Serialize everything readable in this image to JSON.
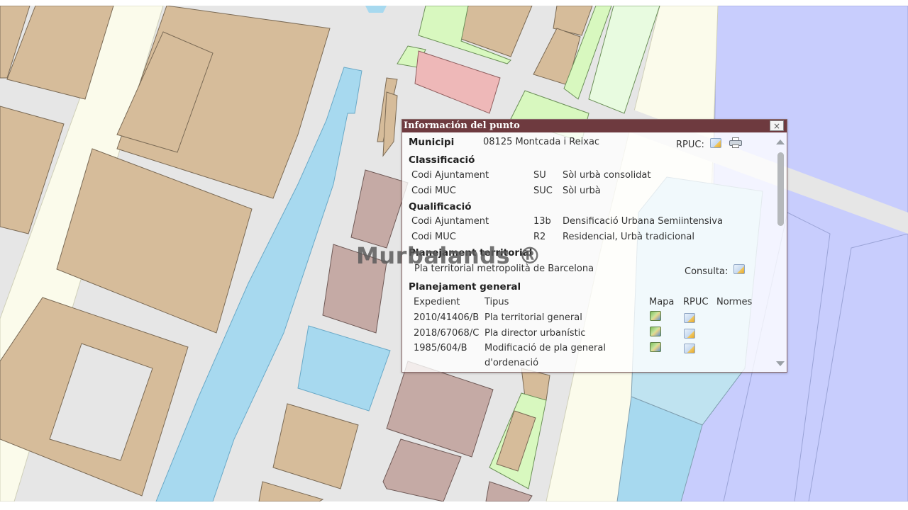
{
  "popup": {
    "title": "Información del punto",
    "close_label": "×",
    "municipi_label": "Municipi",
    "municipi_value": "08125 Montcada i Reixac",
    "rpuc_label": "RPUC:",
    "classificacio": {
      "heading": "Classificació",
      "rows": [
        {
          "label": "Codi Ajuntament",
          "code": "SU",
          "desc": "Sòl urbà consolidat"
        },
        {
          "label": "Codi MUC",
          "code": "SUC",
          "desc": "Sòl urbà"
        }
      ]
    },
    "qualificacio": {
      "heading": "Qualificació",
      "rows": [
        {
          "label": "Codi Ajuntament",
          "code": "13b",
          "desc": "Densificació Urbana Semiintensiva"
        },
        {
          "label": "Codi MUC",
          "code": "R2",
          "desc": "Residencial, Urbà tradicional"
        }
      ]
    },
    "territorial": {
      "heading": "Planejament territorial",
      "value": "Pla territorial metropolità de Barcelona",
      "consulta_label": "Consulta:"
    },
    "general": {
      "heading": "Planejament general",
      "columns": {
        "expedient": "Expedient",
        "tipus": "Tipus",
        "mapa": "Mapa",
        "rpuc": "RPUC",
        "normes": "Normes"
      },
      "rows": [
        {
          "expedient": "2010/41406/B",
          "tipus": "Pla territorial general",
          "tipus2": ""
        },
        {
          "expedient": "2018/67068/C",
          "tipus": "Pla director urbanístic",
          "tipus2": ""
        },
        {
          "expedient": "1985/604/B",
          "tipus": "Modificació de pla general",
          "tipus2": "d'ordenació"
        }
      ]
    }
  },
  "watermark": "Murbalands ®",
  "icons": {
    "close": "close-icon",
    "rpuc": "document-link-icon",
    "print": "printer-icon",
    "map": "map-icon"
  },
  "colors": {
    "parcel": "#d6bc9a",
    "parcel_dark": "#c5aaa5",
    "street": "#e5e5e5",
    "water": "#a7d9ef",
    "sea": "#c8cdfd",
    "green": "#d8f8bf",
    "pink": "#eeb8b8",
    "road": "#fbfbeb",
    "title_bar": "#6e3a3f"
  }
}
